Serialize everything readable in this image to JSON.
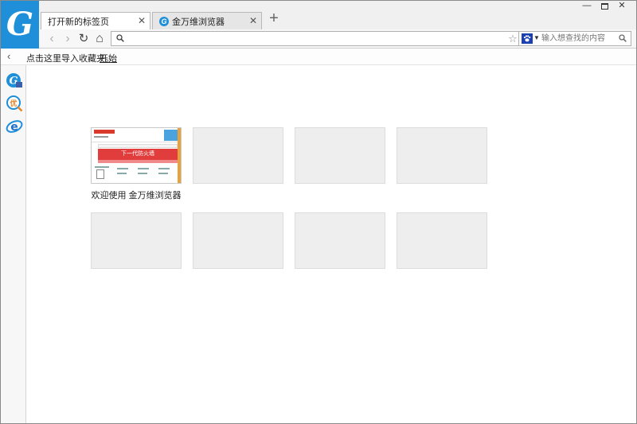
{
  "brand": {
    "logo_letter": "G",
    "accent_color": "#1e8fd8"
  },
  "window_controls": {
    "minimize": "—",
    "close": "✕"
  },
  "tabs": [
    {
      "title": "打开新的标签页",
      "active": true,
      "close": "✕"
    },
    {
      "title": "金万维浏览器",
      "active": false,
      "close": "✕",
      "favicon": "G"
    }
  ],
  "new_tab_symbol": "+",
  "toolbar": {
    "back_icon": "‹",
    "forward_icon": "›",
    "reload_icon": "↻",
    "home_icon": "⌂"
  },
  "address_bar": {
    "value": "",
    "placeholder": "",
    "star_icon": "☆",
    "share_icon": "⇪",
    "bolt_icon": "ϟ"
  },
  "search_box": {
    "placeholder": "输入想查找的内容",
    "engine_icon": "paw-icon"
  },
  "bookmarks_bar": {
    "toggle_icon": "‹",
    "prompt": "点击这里导入收藏夹。",
    "start_link": "开始"
  },
  "sidebar_apps": [
    {
      "name": "gooagoo-app",
      "icon": "G"
    },
    {
      "name": "coupon-app",
      "icon": "优"
    },
    {
      "name": "e-app",
      "icon": "e"
    }
  ],
  "speed_dial": {
    "tiles": [
      {
        "caption": "欢迎使用 金万维浏览器",
        "filled": true,
        "thumb_banner_text": "下一代防火墙"
      },
      {
        "caption": "",
        "filled": false
      },
      {
        "caption": "",
        "filled": false
      },
      {
        "caption": "",
        "filled": false
      },
      {
        "caption": "",
        "filled": false
      },
      {
        "caption": "",
        "filled": false
      },
      {
        "caption": "",
        "filled": false
      },
      {
        "caption": "",
        "filled": false
      }
    ]
  }
}
